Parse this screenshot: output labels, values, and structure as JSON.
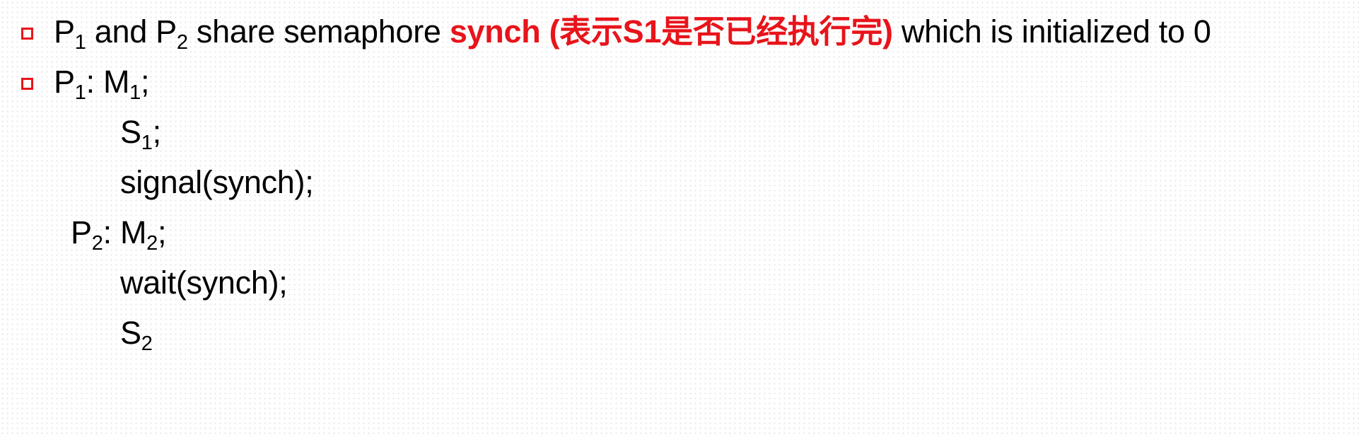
{
  "line1": {
    "p": "P",
    "sub1": "1",
    "and": " and P",
    "sub2": "2",
    "share": " share semaphore ",
    "highlight": "synch (表示S1是否已经执行完)",
    "tail": "  which is initialized to 0"
  },
  "line2": {
    "p": "P",
    "sub1": "1",
    "colon": ":  M",
    "sub2": "1",
    "end": ";"
  },
  "line3": {
    "s": "S",
    "sub": "1",
    "end": ";"
  },
  "line4": {
    "text": "signal(synch);"
  },
  "line5": {
    "p": "P",
    "sub1": "2",
    "colon": ": M",
    "sub2": "2",
    "end": ";"
  },
  "line6": {
    "text": "wait(synch);"
  },
  "line7": {
    "s": "S",
    "sub": "2"
  },
  "colors": {
    "accent": "#e8141b",
    "text": "#000000",
    "background": "#ffffff"
  }
}
